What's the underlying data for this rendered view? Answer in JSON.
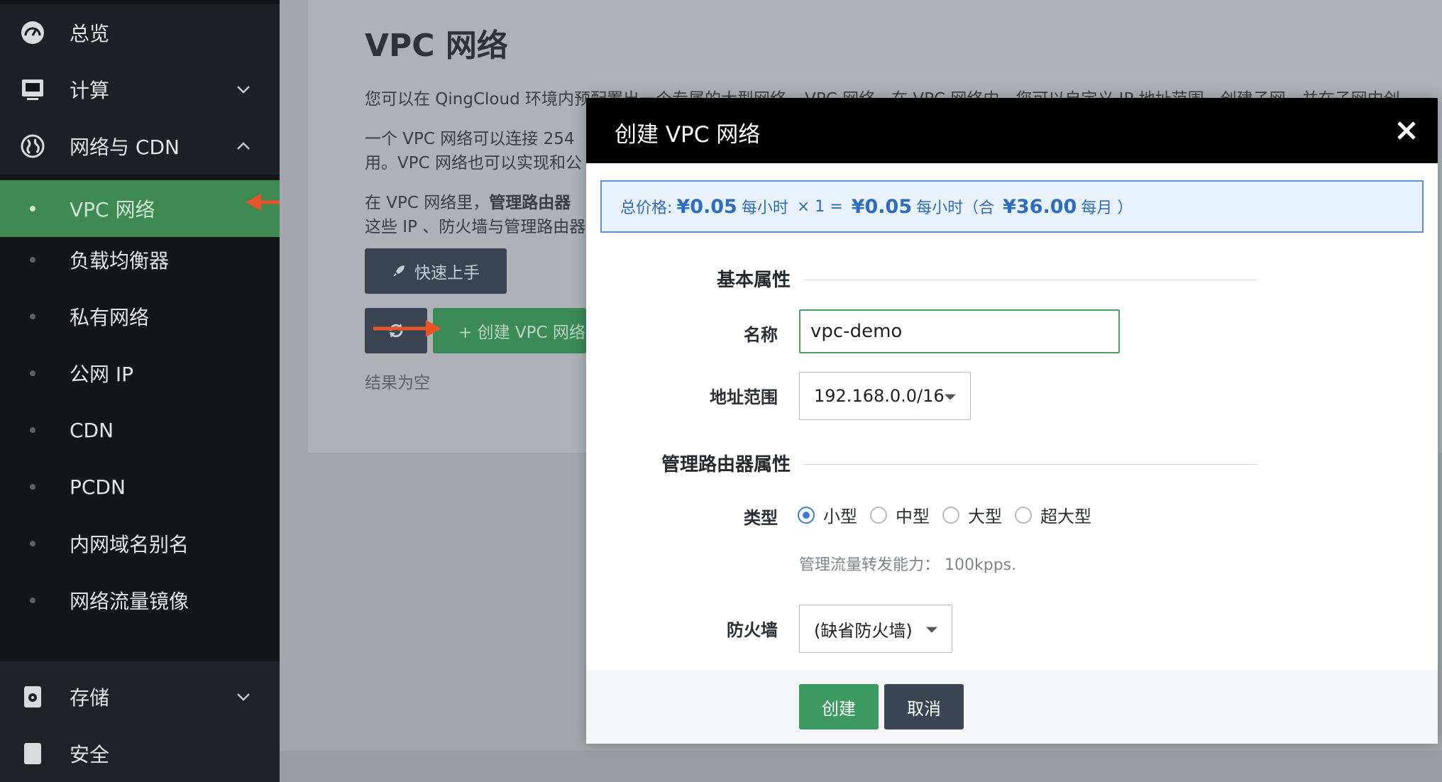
{
  "colors": {
    "sidebar_bg": "#14171a",
    "active_green": "#3f8a53",
    "primary_green": "#3c9a61",
    "dark_button": "#3a4453",
    "price_blue": "#2d6cc0",
    "annotation_arrow": "#e8532a"
  },
  "sidebar": {
    "items": [
      {
        "label": "总览",
        "icon": "dashboard-icon"
      },
      {
        "label": "计算",
        "icon": "monitor-icon",
        "chevron": "down"
      },
      {
        "label": "网络与 CDN",
        "icon": "globe-icon",
        "chevron": "up"
      },
      {
        "label": "VPC 网络",
        "active": true
      },
      {
        "label": "负载均衡器"
      },
      {
        "label": "私有网络"
      },
      {
        "label": "公网 IP"
      },
      {
        "label": "CDN"
      },
      {
        "label": "PCDN"
      },
      {
        "label": "内网域名别名"
      },
      {
        "label": "网络流量镜像"
      },
      {
        "label": "存储",
        "icon": "storage-icon",
        "chevron": "down"
      },
      {
        "label": "安全",
        "icon": "security-icon"
      }
    ]
  },
  "main": {
    "title": "VPC 网络",
    "desc1": "您可以在 QingCloud 环境内预配置出一个专属的大型网络 – VPC 网络。在 VPC 网络内，您可以自定义 IP 地址范围、创建子网，并在子网内创",
    "desc2a": "一个 VPC 网络可以连接 254",
    "desc2b": "用。VPC 网络也可以实现和公",
    "desc3a_pre": "在 VPC 网络里，",
    "desc3a_bold": "管理路由器",
    "desc3b": "这些 IP 、防火墙与管理路由器",
    "quick_start": "快速上手",
    "create_vpc": "+ 创建 VPC 网络",
    "empty": "结果为空"
  },
  "modal": {
    "title": "创建 VPC 网络",
    "price": {
      "label": "总价格:",
      "unit_price": "¥0.05",
      "per_hour": "每小时",
      "multiplier": "× 1 =",
      "total": "¥0.05",
      "per_hour2": "每小时（合",
      "monthly": "¥36.00",
      "per_month": "每月 ）"
    },
    "section_basic": "基本属性",
    "name_label": "名称",
    "name_value": "vpc-demo",
    "range_label": "地址范围",
    "range_value": "192.168.0.0/16",
    "section_router": "管理路由器属性",
    "type_label": "类型",
    "types": [
      "小型",
      "中型",
      "大型",
      "超大型"
    ],
    "selected_type": "小型",
    "type_hint": "管理流量转发能力：  100kpps.",
    "firewall_label": "防火墙",
    "firewall_value": "(缺省防火墙)",
    "create_button": "创建",
    "cancel_button": "取消"
  }
}
